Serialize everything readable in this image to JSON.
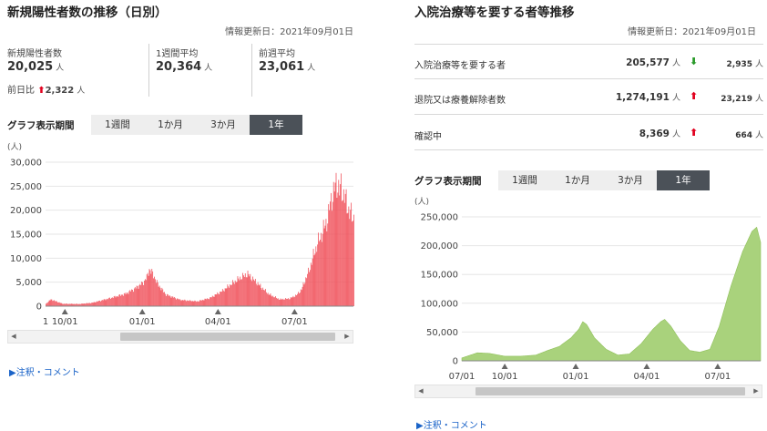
{
  "colors": {
    "left_series": "#f0505a",
    "right_series": "#a9d27c",
    "active_tab": "#4b5158",
    "up_arrow": "#e1001e",
    "down_arrow": "#2a9a2a",
    "link": "#1a63c8"
  },
  "left": {
    "title": "新規陽性者数の推移（日別）",
    "updated": "情報更新日：2021年09月01日",
    "stats": [
      {
        "label": "新規陽性者数",
        "value": "20,025",
        "unit": "人"
      },
      {
        "label": "1週間平均",
        "value": "20,364",
        "unit": "人"
      },
      {
        "label": "前週平均",
        "value": "23,061",
        "unit": "人"
      }
    ],
    "diff": {
      "label": "前日比",
      "arrow": "⬆",
      "value": "2,322",
      "unit": "人"
    },
    "period_label": "グラフ表示期間",
    "tabs": [
      "1週間",
      "1か月",
      "3か月",
      "1年"
    ],
    "active_tab": 3,
    "note_link": "▶注釈・コメント",
    "scroll": {
      "left_arrow": "◀",
      "right_arrow": "▶"
    }
  },
  "right": {
    "title": "入院治療等を要する者等推移",
    "updated": "情報更新日：2021年09月01日",
    "rows": [
      {
        "label": "入院治療等を要する者",
        "value": "205,577",
        "unit": "人",
        "arrow": "⬇",
        "arrow_dir": "down",
        "delta": "2,935",
        "delta_unit": "人"
      },
      {
        "label": "退院又は療養解除者数",
        "value": "1,274,191",
        "unit": "人",
        "arrow": "⬆",
        "arrow_dir": "up",
        "delta": "23,219",
        "delta_unit": "人"
      },
      {
        "label": "確認中",
        "value": "8,369",
        "unit": "人",
        "arrow": "⬆",
        "arrow_dir": "up",
        "delta": "664",
        "delta_unit": "人"
      }
    ],
    "period_label": "グラフ表示期間",
    "tabs": [
      "1週間",
      "1か月",
      "3か月",
      "1年"
    ],
    "active_tab": 3,
    "note_link": "▶注釈・コメント",
    "scroll": {
      "left_arrow": "◀",
      "right_arrow": "▶"
    }
  },
  "chart_data": [
    {
      "type": "bar",
      "ylabel": "(人)",
      "ylim": [
        0,
        30000
      ],
      "yticks": [
        0,
        5000,
        10000,
        15000,
        20000,
        25000,
        30000
      ],
      "ytick_labels": [
        "0",
        "5,000",
        "10,000",
        "15,000",
        "20,000",
        "25,000",
        "30,000"
      ],
      "xtick_labels": [
        "1",
        "10/01",
        "01/01",
        "04/01",
        "07/01"
      ],
      "xtick_positions": [
        0,
        23,
        115,
        205,
        296
      ],
      "n_days": 366,
      "grid": true,
      "legend": "none",
      "series": [
        {
          "keyframes": [
            [
              0,
              500
            ],
            [
              6,
              1400
            ],
            [
              20,
              500
            ],
            [
              40,
              450
            ],
            [
              55,
              700
            ],
            [
              75,
              1600
            ],
            [
              95,
              2600
            ],
            [
              105,
              3600
            ],
            [
              115,
              4800
            ],
            [
              120,
              6000
            ],
            [
              123,
              7700
            ],
            [
              127,
              6800
            ],
            [
              133,
              4600
            ],
            [
              143,
              2400
            ],
            [
              160,
              1300
            ],
            [
              180,
              1000
            ],
            [
              195,
              1700
            ],
            [
              210,
              3200
            ],
            [
              222,
              4800
            ],
            [
              232,
              6000
            ],
            [
              240,
              6700
            ],
            [
              250,
              5000
            ],
            [
              265,
              2500
            ],
            [
              278,
              1400
            ],
            [
              290,
              1600
            ],
            [
              298,
              2300
            ],
            [
              304,
              3500
            ],
            [
              308,
              5300
            ],
            [
              313,
              7500
            ],
            [
              318,
              10500
            ],
            [
              324,
              13500
            ],
            [
              328,
              15000
            ],
            [
              331,
              16500
            ],
            [
              335,
              18000
            ],
            [
              338,
              21500
            ],
            [
              341,
              23000
            ],
            [
              343,
              24500
            ],
            [
              345,
              25500
            ],
            [
              347,
              25200
            ],
            [
              349,
              24000
            ],
            [
              351,
              25000
            ],
            [
              353,
              23500
            ],
            [
              356,
              22500
            ],
            [
              358,
              21000
            ],
            [
              360,
              20025
            ],
            [
              365,
              18500
            ]
          ]
        }
      ]
    },
    {
      "type": "area",
      "ylabel": "(人)",
      "ylim": [
        0,
        250000
      ],
      "yticks": [
        0,
        50000,
        100000,
        150000,
        200000,
        250000
      ],
      "ytick_labels": [
        "0",
        "50,000",
        "100,000",
        "150,000",
        "200,000",
        "250,000"
      ],
      "xtick_labels": [
        "07/01",
        "10/01",
        "01/01",
        "04/01",
        "07/01"
      ],
      "xtick_positions": [
        0,
        55,
        146,
        237,
        328
      ],
      "n_days": 383,
      "grid": true,
      "legend": "none",
      "series": [
        {
          "keyframes": [
            [
              0,
              5000
            ],
            [
              20,
              14000
            ],
            [
              35,
              13000
            ],
            [
              55,
              8000
            ],
            [
              75,
              8000
            ],
            [
              95,
              10000
            ],
            [
              110,
              18000
            ],
            [
              125,
              25000
            ],
            [
              140,
              40000
            ],
            [
              150,
              55000
            ],
            [
              155,
              68000
            ],
            [
              160,
              63000
            ],
            [
              170,
              40000
            ],
            [
              185,
              20000
            ],
            [
              200,
              10000
            ],
            [
              215,
              12000
            ],
            [
              230,
              30000
            ],
            [
              245,
              55000
            ],
            [
              255,
              68000
            ],
            [
              260,
              72000
            ],
            [
              268,
              60000
            ],
            [
              280,
              35000
            ],
            [
              292,
              18000
            ],
            [
              305,
              15000
            ],
            [
              318,
              20000
            ],
            [
              330,
              60000
            ],
            [
              345,
              130000
            ],
            [
              360,
              190000
            ],
            [
              372,
              225000
            ],
            [
              378,
              232000
            ],
            [
              383,
              205577
            ]
          ]
        }
      ]
    }
  ]
}
